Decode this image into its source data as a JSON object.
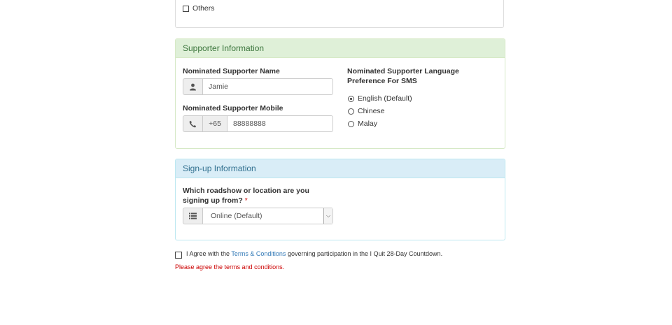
{
  "top_section": {
    "others_label": "Others",
    "others_checked": false
  },
  "supporter": {
    "heading": "Supporter Information",
    "name_label": "Nominated Supporter Name",
    "name_value": "Jamie",
    "mobile_label": "Nominated Supporter Mobile",
    "country_code": "+65",
    "mobile_value": "88888888",
    "language_label_line1": "Nominated Supporter Language",
    "language_label_line2": "Preference For SMS",
    "language_options": [
      {
        "label": "English (Default)",
        "selected": true
      },
      {
        "label": "Chinese",
        "selected": false
      },
      {
        "label": "Malay",
        "selected": false
      }
    ]
  },
  "signup": {
    "heading": "Sign-up Information",
    "question_line1": "Which roadshow or location are you",
    "question_line2": "signing up from?",
    "required_mark": "*",
    "selected_option": "Online (Default)"
  },
  "agreement": {
    "text_before": "I Agree with the",
    "link_text": "Terms & Conditions",
    "text_after": "governing participation in the I Quit 28-Day Countdown.",
    "checked": false,
    "error": "Please agree the terms and conditions."
  },
  "colors": {
    "success_bg": "#dff0d8",
    "success_text": "#3c763d",
    "info_bg": "#d9edf7",
    "info_text": "#31708f",
    "link": "#337ab7",
    "error": "#cc0000"
  },
  "icons": {
    "name_addon": "user-icon",
    "mobile_addon": "phone-icon",
    "location_addon": "list-icon",
    "select_arrow": "chevron-down-icon"
  }
}
